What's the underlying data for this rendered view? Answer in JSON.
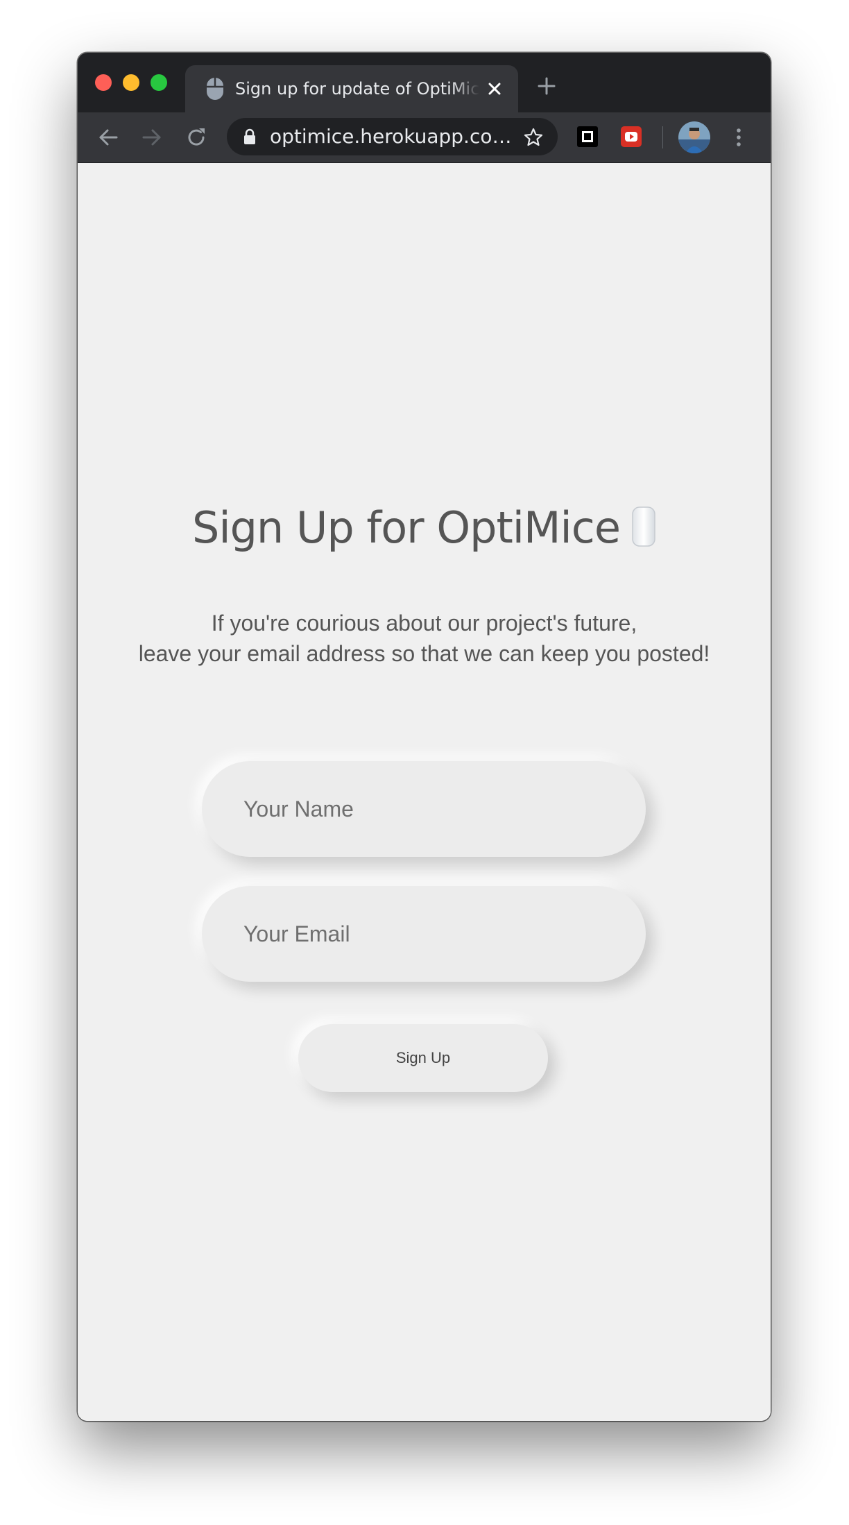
{
  "browser": {
    "tab": {
      "title": "Sign up for update of OptiMice",
      "favicon": "mouse-icon"
    },
    "address_bar": {
      "url": "optimice.herokuapp.co…"
    },
    "colors": {
      "tab_strip": "#202124",
      "toolbar": "#35363a",
      "close": "#fe5f57",
      "minimize": "#febc2e",
      "zoom": "#28c840"
    }
  },
  "page": {
    "heading": "Sign Up for OptiMice",
    "heading_emoji": "computer-mouse-icon",
    "subtitle_line1": "If you're courious about our project's future,",
    "subtitle_line2": "leave your email address so that we can keep you posted!",
    "form": {
      "name_placeholder": "Your Name",
      "name_value": "",
      "email_placeholder": "Your Email",
      "email_value": "",
      "submit_label": "Sign Up"
    },
    "colors": {
      "background": "#f0f0f0",
      "text": "#555555"
    }
  }
}
